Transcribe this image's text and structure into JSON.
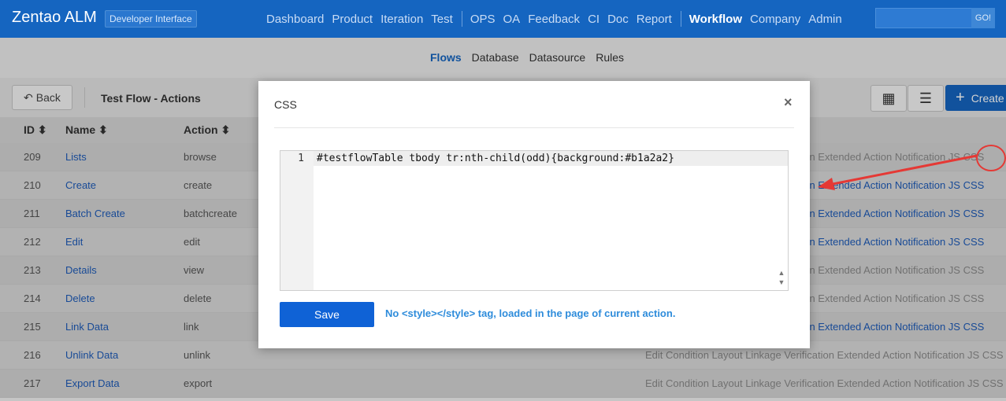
{
  "app": {
    "brand": "Zentao ALM",
    "badge": "Developer Interface",
    "nav": [
      "Dashboard",
      "Product",
      "Iteration",
      "Test",
      "OPS",
      "OA",
      "Feedback",
      "CI",
      "Doc",
      "Report",
      "Workflow",
      "Company",
      "Admin"
    ],
    "nav_active": "Workflow",
    "search_button": "GO!"
  },
  "subnav": {
    "items": [
      "Flows",
      "Database",
      "Datasource",
      "Rules"
    ],
    "active": "Flows"
  },
  "toolbar": {
    "back_label": "Back",
    "title": "Test Flow - Actions",
    "create_label": "Create"
  },
  "table": {
    "headers": [
      "ID",
      "Name",
      "Action"
    ],
    "rows": [
      {
        "id": "209",
        "name": "Lists",
        "code": "browse"
      },
      {
        "id": "210",
        "name": "Create",
        "code": "create"
      },
      {
        "id": "211",
        "name": "Batch Create",
        "code": "batchcreate"
      },
      {
        "id": "212",
        "name": "Edit",
        "code": "edit"
      },
      {
        "id": "213",
        "name": "Details",
        "code": "view"
      },
      {
        "id": "214",
        "name": "Delete",
        "code": "delete"
      },
      {
        "id": "215",
        "name": "Link Data",
        "code": "link"
      },
      {
        "id": "216",
        "name": "Unlink Data",
        "code": "unlink"
      },
      {
        "id": "217",
        "name": "Export Data",
        "code": "export"
      }
    ],
    "action_links": {
      "row_209": "cation Extended Action Notification JS CSS",
      "row_210": "cation Extended Action Notification JS CSS",
      "row_211": "cation Extended Action Notification JS CSS",
      "row_212": "cation Extended Action Notification JS CSS",
      "row_213": "cation Extended Action Notification JS CSS",
      "row_214": "cation Extended Action Notification JS CSS",
      "row_215": "cation Extended Action Notification JS CSS",
      "row_216": "Edit Condition Layout Linkage Verification Extended Action Notification JS CSS",
      "row_217": "Edit Condition Layout Linkage Verification Extended Action Notification JS CSS"
    }
  },
  "modal": {
    "title": "CSS",
    "close_glyph": "×",
    "line_number": "1",
    "code": "#testflowTable tbody tr:nth-child(odd){background:#b1a2a2}",
    "save_label": "Save",
    "hint": "No <style></style> tag, loaded in the page of current action."
  },
  "colors": {
    "primary": "#1565c0",
    "link": "#1e5bb8",
    "annotation": "#e53935"
  }
}
